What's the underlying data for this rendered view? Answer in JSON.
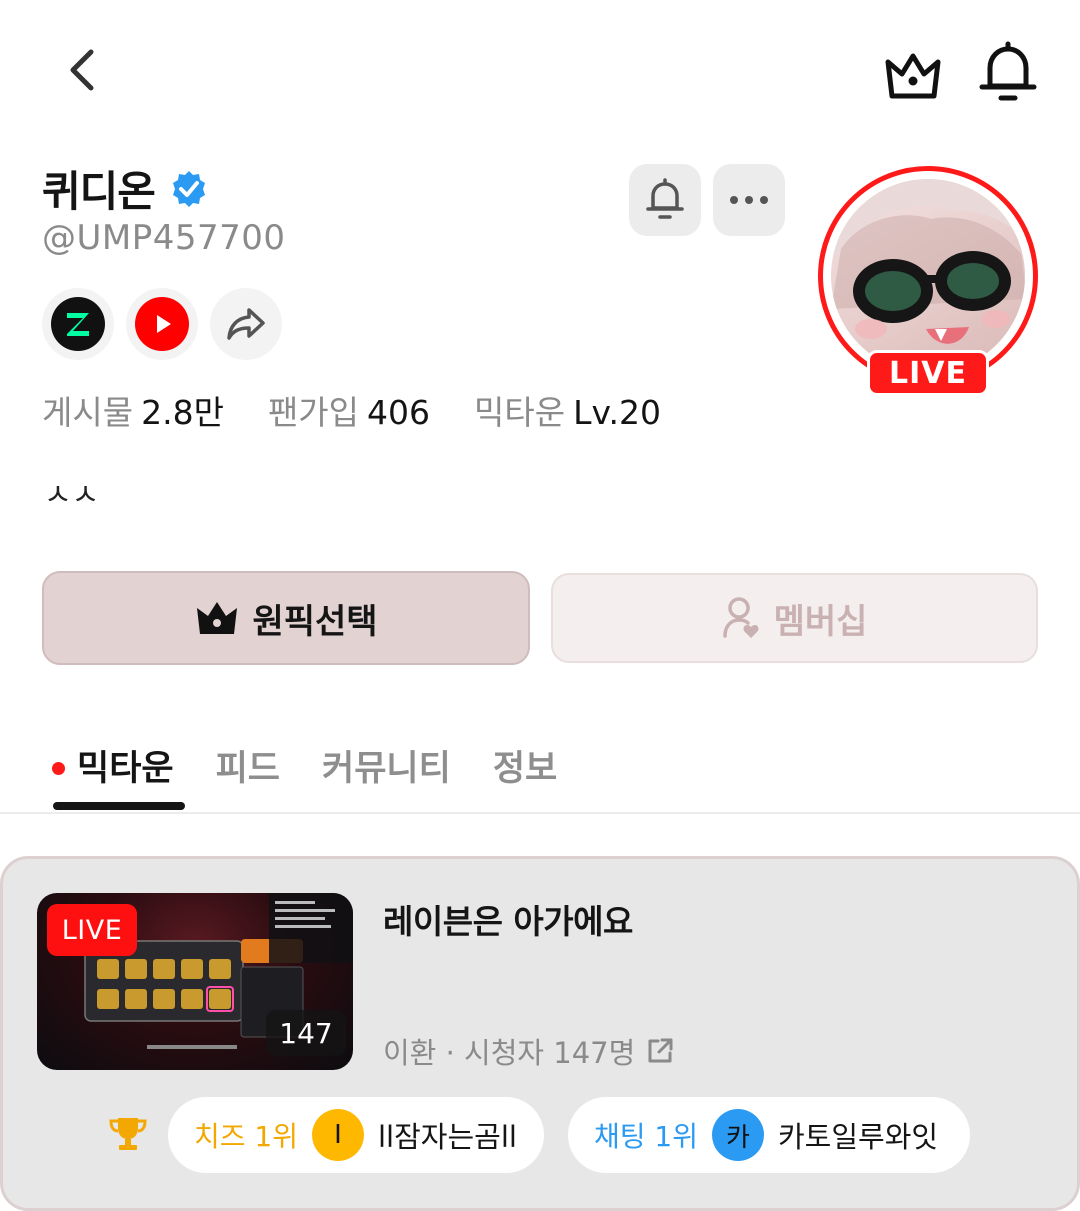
{
  "header": {
    "back_icon": "chevron-left-icon",
    "crown_icon": "crown-icon",
    "bell_icon": "bell-icon"
  },
  "profile": {
    "name": "퀴디온",
    "verified_icon": "verified-badge-icon",
    "handle": "@UMP457700",
    "bio": "ㅅㅅ",
    "live_badge": "LIVE",
    "stats": [
      {
        "label": "게시물",
        "value": "2.8만"
      },
      {
        "label": "팬가입",
        "value": "406"
      },
      {
        "label": "믹타운",
        "value": "Lv.20"
      }
    ],
    "socials": [
      "chzzk-icon",
      "youtube-icon",
      "share-icon"
    ]
  },
  "actions": {
    "pick_label": "원픽선택",
    "membership_label": "멤버십"
  },
  "tabs": [
    {
      "label": "믹타운",
      "active": true
    },
    {
      "label": "피드",
      "active": false
    },
    {
      "label": "커뮤니티",
      "active": false
    },
    {
      "label": "정보",
      "active": false
    }
  ],
  "live_card": {
    "live_label": "LIVE",
    "viewer_badge": "147",
    "title": "레이븐은 아가에요",
    "meta": "이환 · 시청자 147명",
    "rankings": [
      {
        "label": "치즈 1위",
        "avatar": "I",
        "name": "ll잠자는곰ll",
        "color": "#f2a800"
      },
      {
        "label": "채팅 1위",
        "avatar": "카",
        "name": "카토일루와잇",
        "color": "#2b9af3"
      }
    ]
  },
  "colors": {
    "accent_red": "#ff1a1a",
    "pick_button_bg": "#e2d2d2",
    "member_button_bg": "#f4eeee",
    "card_bg": "#e7e7e7"
  }
}
